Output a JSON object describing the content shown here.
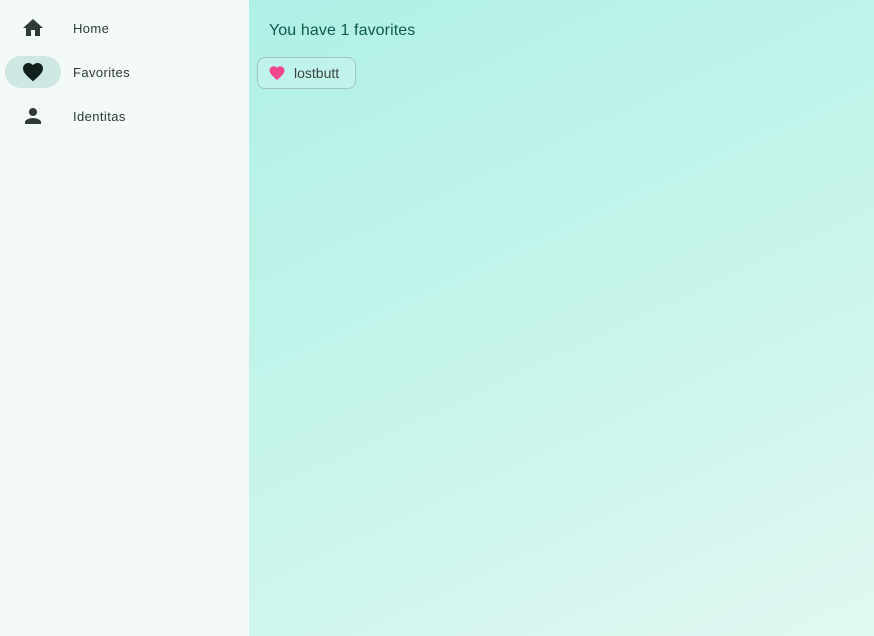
{
  "sidebar": {
    "items": [
      {
        "label": "Home",
        "icon": "home-icon",
        "active": false
      },
      {
        "label": "Favorites",
        "icon": "heart-icon",
        "active": true
      },
      {
        "label": "Identitas",
        "icon": "person-icon",
        "active": false
      }
    ]
  },
  "main": {
    "title": "You have 1 favorites",
    "favorites": [
      {
        "label": "lostbutt",
        "icon": "heart-icon"
      }
    ]
  },
  "colors": {
    "heart_accent": "#f0468f",
    "title_text": "#0e5a4f",
    "active_indicator": "#cde8e2"
  }
}
